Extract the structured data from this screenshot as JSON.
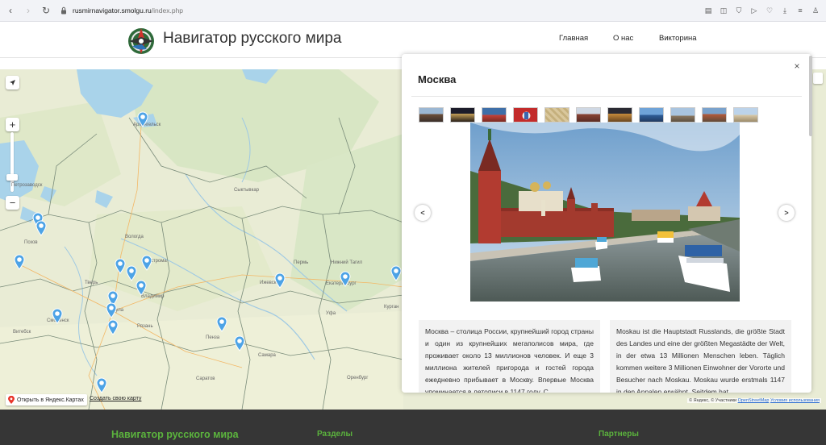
{
  "browser": {
    "url_host": "rusmirnavigator.smolgu.ru",
    "url_path": "/index.php"
  },
  "header": {
    "title": "Навигатор русского мира",
    "menu": [
      "Главная",
      "О нас",
      "Викторина"
    ]
  },
  "map": {
    "cities": [
      {
        "name": "Архангельск"
      },
      {
        "name": "Петрозаводск"
      },
      {
        "name": "Сыктывкар"
      },
      {
        "name": "Вологда"
      },
      {
        "name": "Кострома"
      },
      {
        "name": "Тверь"
      },
      {
        "name": "Владимир"
      },
      {
        "name": "Смоленск"
      },
      {
        "name": "Рязань"
      },
      {
        "name": "Пенза"
      },
      {
        "name": "Ижевск"
      },
      {
        "name": "Пермь"
      },
      {
        "name": "Нижний Тагил"
      },
      {
        "name": "Екатеринбург"
      },
      {
        "name": "Курган"
      },
      {
        "name": "Саратов"
      },
      {
        "name": "Самара"
      },
      {
        "name": "Оренбург"
      },
      {
        "name": "Витебск"
      },
      {
        "name": "Псков"
      },
      {
        "name": "Тула"
      },
      {
        "name": "Уфа"
      }
    ],
    "open_in_yandex": "Открыть в Яндекс.Картах",
    "create_map": "Создать свою карту",
    "copyright_prefix": "© Яндекс, © Участники",
    "copyright_osm": "OpenStreetMap",
    "copyright_terms": "Условия использования"
  },
  "modal": {
    "title": "Москва",
    "close_glyph": "×",
    "prev_glyph": "<",
    "next_glyph": ">",
    "text_ru": "Москва – столица России, крупнейший город страны и один из крупнейших мегаполисов мира, где проживает около 13 миллионов человек. И еще 3 миллиона жителей пригорода и гостей города ежедневно прибывает в Москву. Впервые Москва упоминается в летописи в 1147 году. С",
    "text_de": "Moskau ist die Hauptstadt Russlands, die größte Stadt des Landes und eine der größten Megastädte der Welt, in der etwa 13 Millionen Menschen leben. Täglich kommen weitere 3 Millionen Einwohner der Vororte und Besucher nach Moskau. Moskau wurde erstmals 1147 in den Annalen erwähnt. Seitdem hat"
  },
  "footer": {
    "title": "Навигатор русского мира",
    "sections": "Разделы",
    "partners": "Партнеры"
  },
  "colors": {
    "footer_accent": "#5bb33d",
    "footer_bg": "#363636",
    "marker": "#4da3e6",
    "water": "#a9d3ea",
    "land": "#e9ecd5"
  }
}
